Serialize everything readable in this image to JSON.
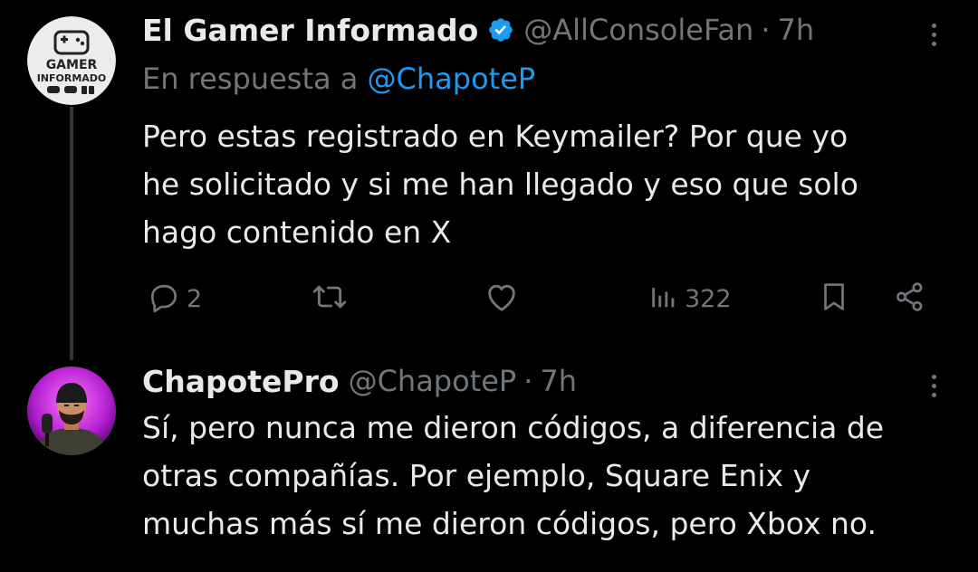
{
  "tweet1": {
    "display_name": "El Gamer Informado",
    "handle": "@AllConsoleFan",
    "separator": "·",
    "time": "7h",
    "reply_prefix": "En respuesta a",
    "reply_mention": "@ChapoteP",
    "text_lines": [
      "Pero estas registrado en Keymailer? Por que yo",
      "he solicitado y si me han llegado y eso que solo",
      "hago contenido en X"
    ],
    "avatar_text": [
      "GAMER",
      "INFORMADO"
    ],
    "actions": {
      "replies": "2",
      "reposts": "",
      "likes": "",
      "views": "322"
    }
  },
  "tweet2": {
    "display_name": "ChapotePro",
    "handle": "@ChapoteP",
    "separator": "·",
    "time": "7h",
    "text_lines": [
      "Sí, pero nunca me dieron códigos, a diferencia de",
      "otras compañías. Por ejemplo, Square Enix y",
      "muchas más sí me dieron códigos, pero Xbox no."
    ]
  },
  "icons": {
    "verified": "verified-badge-icon",
    "reply": "reply-icon",
    "repost": "repost-icon",
    "like": "heart-icon",
    "views": "views-icon",
    "bookmark": "bookmark-icon",
    "share": "share-icon",
    "more": "more-icon"
  },
  "colors": {
    "background": "#000000",
    "primary_text": "#e7e9ea",
    "secondary_text": "#71767b",
    "link": "#1d9bf0",
    "verified": "#1d9bf0",
    "thread_line": "#333639"
  }
}
